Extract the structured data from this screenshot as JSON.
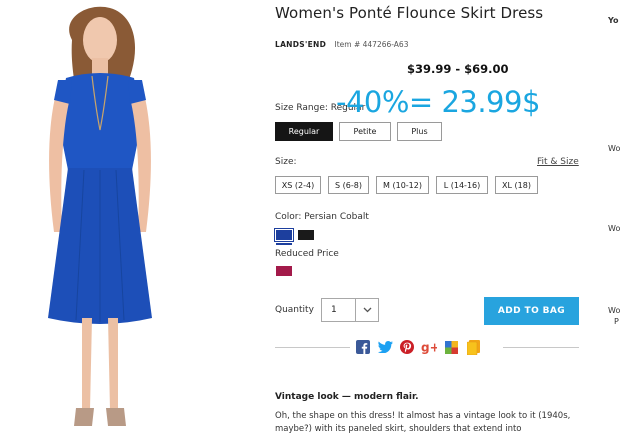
{
  "product": {
    "title": "Women's Ponté Flounce Skirt Dress",
    "brand": "LANDS'END",
    "item_number": "Item # 447266-A63",
    "price_range": "$39.99 - $69.00",
    "discount_overlay": "-40%= 23.99$"
  },
  "size_range": {
    "label": "Size Range: Regular",
    "options": [
      "Regular",
      "Petite",
      "Plus"
    ],
    "selected": "Regular"
  },
  "size": {
    "label": "Size:",
    "fit_link": "Fit & Size",
    "options": [
      "XS (2-4)",
      "S (6-8)",
      "M (10-12)",
      "L (14-16)",
      "XL (18)"
    ]
  },
  "color": {
    "label": "Color: Persian Cobalt",
    "swatches": [
      "#1d3f9e",
      "#1a1a1a"
    ],
    "reduced_label": "Reduced Price",
    "reduced_swatch": "#a31a4a"
  },
  "purchase": {
    "quantity_label": "Quantity",
    "quantity_value": "1",
    "add_button": "ADD TO BAG",
    "button_color": "#28a3de"
  },
  "share_icons": [
    "facebook-icon",
    "twitter-icon",
    "pinterest-icon",
    "google-plus-icon",
    "delicious-icon",
    "gift-icon"
  ],
  "description": {
    "heading": "Vintage look — modern flair.",
    "body": "Oh, the shape on this dress! It almost has a vintage look to it (1940s, maybe?) with its paneled skirt, shoulders that extend into"
  },
  "side_column": {
    "line1": "Yo",
    "line2": "Wo",
    "line3": "Wo",
    "line4": "Wo",
    "line5": "P"
  }
}
